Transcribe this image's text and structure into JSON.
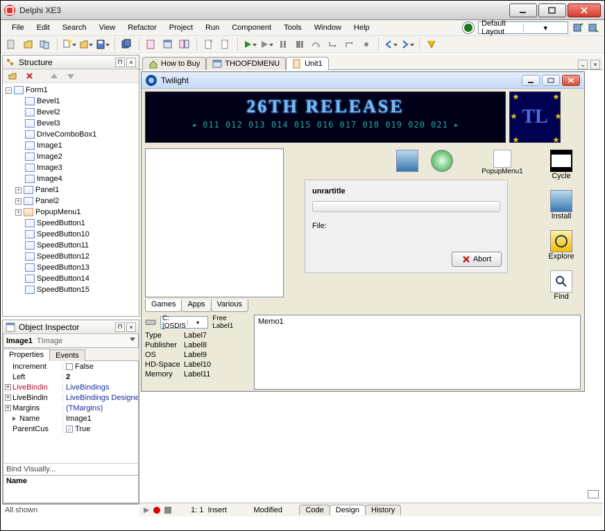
{
  "window": {
    "title": "Delphi XE3"
  },
  "menus": [
    "File",
    "Edit",
    "Search",
    "View",
    "Refactor",
    "Project",
    "Run",
    "Component",
    "Tools",
    "Window",
    "Help"
  ],
  "layout_combo": "Default Layout",
  "structure_panel_title": "Structure",
  "tree": {
    "root": "Form1",
    "items": [
      "Bevel1",
      "Bevel2",
      "Bevel3",
      "DriveComboBox1",
      "Image1",
      "Image2",
      "Image3",
      "Image4",
      "Panel1",
      "Panel2",
      "PopupMenu1",
      "SpeedButton1",
      "SpeedButton10",
      "SpeedButton11",
      "SpeedButton12",
      "SpeedButton13",
      "SpeedButton14",
      "SpeedButton15"
    ]
  },
  "object_inspector": {
    "title": "Object Inspector",
    "obj_name": "Image1",
    "obj_type": "TImage",
    "tabs": [
      "Properties",
      "Events"
    ],
    "rows": [
      {
        "exp": "",
        "name": "Increment",
        "val": "False",
        "check": true
      },
      {
        "exp": "",
        "name": "Left",
        "val": "2",
        "bold": true
      },
      {
        "exp": "+",
        "name": "LiveBindin",
        "val": "LiveBindings",
        "namecolor": "#b01030",
        "valcolor": "#1530a0"
      },
      {
        "exp": "+",
        "name": "LiveBindin",
        "val": "LiveBindings Designer",
        "valcolor": "#1530a0"
      },
      {
        "exp": "+",
        "name": "Margins",
        "val": "(TMargins)",
        "valcolor": "#1530a0"
      },
      {
        "exp": "",
        "name": "Name",
        "val": "Image1",
        "sel": true
      },
      {
        "exp": "",
        "name": "ParentCus",
        "val": "True",
        "check": true,
        "checked": true
      }
    ],
    "footer_link": "Bind Visually...",
    "footer_label": "Name",
    "status": "All shown"
  },
  "doc_tabs": [
    {
      "label": "How to Buy",
      "icon": "home"
    },
    {
      "label": "THOOFDMENU",
      "icon": "form"
    },
    {
      "label": "Unit1",
      "icon": "unit",
      "active": true
    }
  ],
  "form": {
    "title": "Twilight",
    "banner_text": "26TH RELEASE",
    "banner_nums_prefix": "◂",
    "banner_nums": [
      "011",
      "012",
      "013",
      "014",
      "015",
      "016",
      "017",
      "018",
      "019",
      "020",
      "021"
    ],
    "banner_nums_suffix": "▸",
    "badge": "TL",
    "list_tabs": [
      "Games",
      "Apps",
      "Various"
    ],
    "unrar_title": "unrartitle",
    "file_label": "File:",
    "abort_label": "Abort",
    "big_buttons": [
      "Cycle",
      "Install",
      "Explore",
      "Find"
    ],
    "popup_label": "PopupMenu1",
    "drive_combo": "C: [OSDIS",
    "free_label": "Free Label1",
    "info_rows": [
      {
        "k": "Type",
        "v": "Label7"
      },
      {
        "k": "Publisher",
        "v": "Label8"
      },
      {
        "k": "OS",
        "v": "Label9"
      },
      {
        "k": "HD-Space",
        "v": "Label10"
      },
      {
        "k": "Memory",
        "v": "Label11"
      }
    ],
    "memo": "Memo1"
  },
  "view_tabs": [
    "Code",
    "Design",
    "History"
  ],
  "statusbar": {
    "pos": "1: 1",
    "mode": "Insert",
    "state": "Modified",
    "arrow": "▶"
  }
}
